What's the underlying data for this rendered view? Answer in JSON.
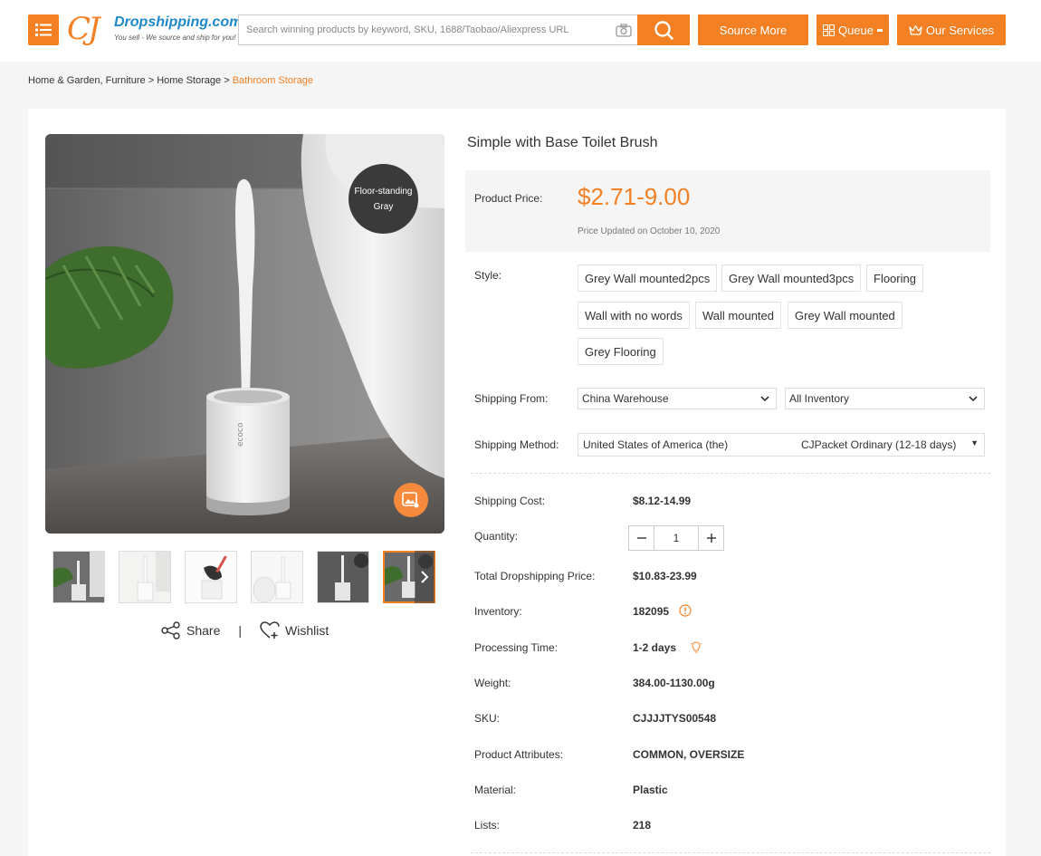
{
  "header": {
    "logo_mark": "CJ",
    "logo_name": "Dropshipping.com",
    "logo_tagline": "You sell - We source and ship for you!",
    "search_placeholder": "Search winning products by keyword, SKU, 1688/Taobao/Aliexpress URL",
    "source_more_label": "Source More",
    "queue_label": "Queue",
    "services_label": "Our Services",
    "accent_color": "#f48024"
  },
  "breadcrumb": {
    "items": [
      "Home & Garden, Furniture",
      "Home Storage"
    ],
    "separator": ">",
    "current": "Bathroom Storage"
  },
  "gallery": {
    "badge_line1": "Floor-standing",
    "badge_line2": "Gray",
    "brand_print": "ecoco",
    "share_label": "Share",
    "separator": "|",
    "wishlist_label": "Wishlist",
    "thumb_count": 6,
    "active_thumb_index": 5
  },
  "product": {
    "title": "Simple with Base Toilet Brush",
    "price_label": "Product Price:",
    "price": "$2.71-9.00",
    "price_updated": "Price Updated on October 10, 2020",
    "style_label": "Style:",
    "styles": [
      "Grey Wall mounted2pcs",
      "Grey Wall mounted3pcs",
      "Flooring",
      "Wall with no words",
      "Wall mounted",
      "Grey Wall mounted",
      "Grey Flooring"
    ],
    "shipping_from_label": "Shipping From:",
    "shipping_from": "China Warehouse",
    "inventory_filter": "All Inventory",
    "shipping_method_label": "Shipping Method:",
    "shipping_country": "United States of America (the)",
    "shipping_method": "CJPacket Ordinary (12-18 days)",
    "details": {
      "shipping_cost_label": "Shipping Cost:",
      "shipping_cost": "$8.12-14.99",
      "quantity_label": "Quantity:",
      "quantity": "1",
      "total_label": "Total Dropshipping Price:",
      "total": "$10.83-23.99",
      "inventory_label": "Inventory:",
      "inventory": "182095",
      "processing_label": "Processing Time:",
      "processing": "1-2 days",
      "weight_label": "Weight:",
      "weight": "384.00-1130.00g",
      "sku_label": "SKU:",
      "sku": "CJJJJTYS00548",
      "attributes_label": "Product Attributes:",
      "attributes": "COMMON, OVERSIZE",
      "material_label": "Material:",
      "material": "Plastic",
      "lists_label": "Lists:",
      "lists": "218"
    }
  }
}
